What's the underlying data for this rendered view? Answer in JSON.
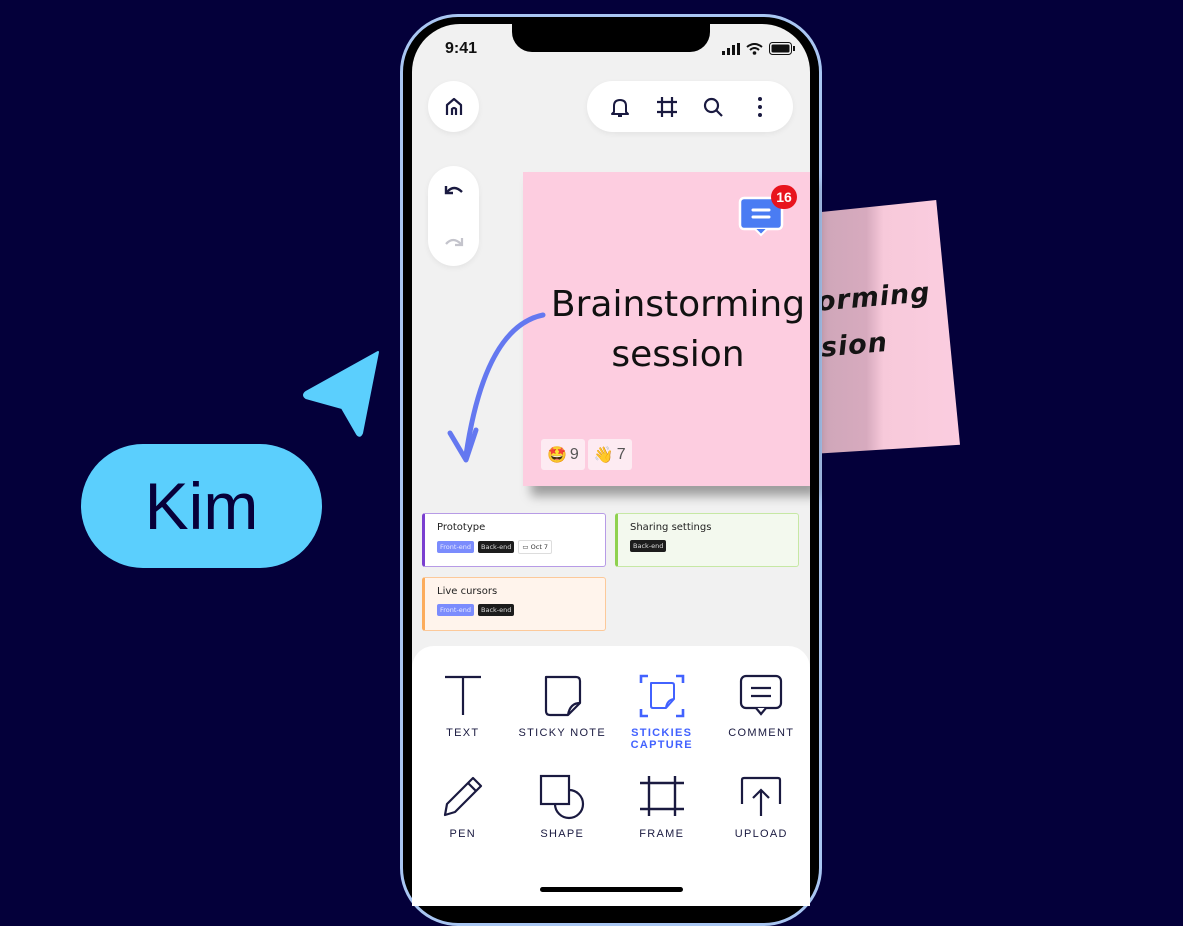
{
  "status_bar": {
    "time": "9:41"
  },
  "top_bar": {
    "home_icon": "home-icon",
    "actions": [
      "bell-icon",
      "frame-icon",
      "search-icon",
      "more-vertical-icon"
    ]
  },
  "history": {
    "undo_icon": "undo-icon",
    "redo_icon": "redo-icon"
  },
  "main_sticky": {
    "title_line1": "Brainstorming",
    "title_line2": "session",
    "color": "#fdcde0",
    "comment_count": "16",
    "reactions": [
      {
        "emoji": "🤩",
        "count": "9"
      },
      {
        "emoji": "👋",
        "count": "7"
      }
    ]
  },
  "photo_sticky": {
    "line1": "orming",
    "line2": "sion"
  },
  "cards": [
    {
      "title": "Prototype",
      "tags": [
        "Front-end",
        "Back-end"
      ],
      "date": "Oct 7",
      "accent": "#7a3fd0",
      "bg": "#ffffff"
    },
    {
      "title": "Sharing settings",
      "tags": [
        "Back-end"
      ],
      "accent": "#8fd14f",
      "bg": "#f3f9ee"
    },
    {
      "title": "Live cursors",
      "tags": [
        "Front-end",
        "Back-end"
      ],
      "accent": "#fcac5c",
      "bg": "#fff4ec"
    }
  ],
  "tools": [
    {
      "label": "TEXT",
      "icon": "text-icon"
    },
    {
      "label": "STICKY NOTE",
      "icon": "sticky-note-icon"
    },
    {
      "label_line1": "STICKIES",
      "label_line2": "CAPTURE",
      "icon": "stickies-capture-icon",
      "active": true
    },
    {
      "label": "COMMENT",
      "icon": "comment-icon"
    },
    {
      "label": "PEN",
      "icon": "pen-icon"
    },
    {
      "label": "SHAPE",
      "icon": "shape-icon"
    },
    {
      "label": "FRAME",
      "icon": "frame-icon"
    },
    {
      "label": "UPLOAD",
      "icon": "upload-icon"
    }
  ],
  "cursor": {
    "name": "Kim",
    "color": "#5bcffd"
  }
}
